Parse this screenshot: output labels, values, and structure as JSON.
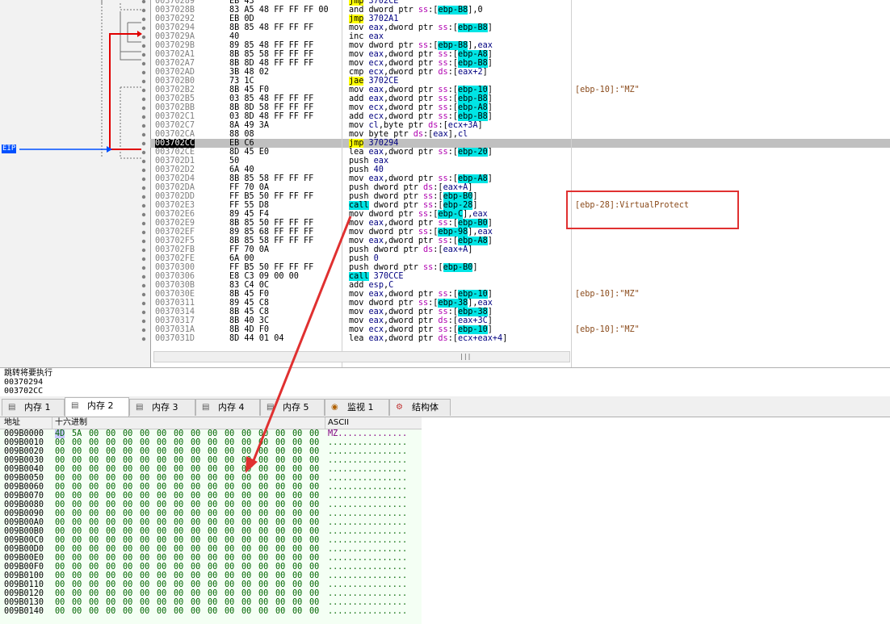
{
  "cpu": {
    "eip_label": "EIP",
    "rows": [
      {
        "addr": "00370289",
        "bytes": "EB 43",
        "dis": [
          [
            "jmp",
            "jmp"
          ],
          [
            "num",
            " 3702CE"
          ]
        ],
        "cmt": ""
      },
      {
        "addr": "0037028B",
        "bytes": "83 A5 48 FF FF FF 00",
        "dis": [
          [
            "t",
            "and dword ptr "
          ],
          [
            "seg",
            "ss"
          ],
          [
            "t",
            ":["
          ],
          [
            "br",
            "ebp-B8"
          ],
          [
            "t",
            "],0"
          ]
        ],
        "cmt": ""
      },
      {
        "addr": "00370292",
        "bytes": "EB 0D",
        "dis": [
          [
            "jmp",
            "jmp"
          ],
          [
            "num",
            " 3702A1"
          ]
        ],
        "cmt": ""
      },
      {
        "addr": "00370294",
        "bytes": "8B 85 48 FF FF FF",
        "dis": [
          [
            "t",
            "mov "
          ],
          [
            "reg",
            "eax"
          ],
          [
            "t",
            ",dword ptr "
          ],
          [
            "seg",
            "ss"
          ],
          [
            "t",
            ":["
          ],
          [
            "br",
            "ebp-B8"
          ],
          [
            "t",
            "]"
          ]
        ],
        "cmt": ""
      },
      {
        "addr": "0037029A",
        "bytes": "40",
        "dis": [
          [
            "t",
            "inc "
          ],
          [
            "reg",
            "eax"
          ]
        ],
        "cmt": ""
      },
      {
        "addr": "0037029B",
        "bytes": "89 85 48 FF FF FF",
        "dis": [
          [
            "t",
            "mov dword ptr "
          ],
          [
            "seg",
            "ss"
          ],
          [
            "t",
            ":["
          ],
          [
            "br",
            "ebp-B8"
          ],
          [
            "t",
            "],"
          ],
          [
            "reg",
            "eax"
          ]
        ],
        "cmt": ""
      },
      {
        "addr": "003702A1",
        "bytes": "8B 85 58 FF FF FF",
        "dis": [
          [
            "t",
            "mov "
          ],
          [
            "reg",
            "eax"
          ],
          [
            "t",
            ",dword ptr "
          ],
          [
            "seg",
            "ss"
          ],
          [
            "t",
            ":["
          ],
          [
            "br",
            "ebp-A8"
          ],
          [
            "t",
            "]"
          ]
        ],
        "cmt": ""
      },
      {
        "addr": "003702A7",
        "bytes": "8B 8D 48 FF FF FF",
        "dis": [
          [
            "t",
            "mov "
          ],
          [
            "reg",
            "ecx"
          ],
          [
            "t",
            ",dword ptr "
          ],
          [
            "seg",
            "ss"
          ],
          [
            "t",
            ":["
          ],
          [
            "br",
            "ebp-B8"
          ],
          [
            "t",
            "]"
          ]
        ],
        "cmt": ""
      },
      {
        "addr": "003702AD",
        "bytes": "3B 48 02",
        "dis": [
          [
            "t",
            "cmp "
          ],
          [
            "reg",
            "ecx"
          ],
          [
            "t",
            ",dword ptr "
          ],
          [
            "seg",
            "ds"
          ],
          [
            "t",
            ":["
          ],
          [
            "reg",
            "eax+2"
          ],
          [
            "t",
            "]"
          ]
        ],
        "cmt": ""
      },
      {
        "addr": "003702B0",
        "bytes": "73 1C",
        "dis": [
          [
            "jmp",
            "jae"
          ],
          [
            "num",
            " 3702CE"
          ]
        ],
        "cmt": ""
      },
      {
        "addr": "003702B2",
        "bytes": "8B 45 F0",
        "dis": [
          [
            "t",
            "mov "
          ],
          [
            "reg",
            "eax"
          ],
          [
            "t",
            ",dword ptr "
          ],
          [
            "seg",
            "ss"
          ],
          [
            "t",
            ":["
          ],
          [
            "br",
            "ebp-10"
          ],
          [
            "t",
            "]"
          ]
        ],
        "cmt": "[ebp-10]:\"MZ\""
      },
      {
        "addr": "003702B5",
        "bytes": "03 85 48 FF FF FF",
        "dis": [
          [
            "t",
            "add "
          ],
          [
            "reg",
            "eax"
          ],
          [
            "t",
            ",dword ptr "
          ],
          [
            "seg",
            "ss"
          ],
          [
            "t",
            ":["
          ],
          [
            "br",
            "ebp-B8"
          ],
          [
            "t",
            "]"
          ]
        ],
        "cmt": ""
      },
      {
        "addr": "003702BB",
        "bytes": "8B 8D 58 FF FF FF",
        "dis": [
          [
            "t",
            "mov "
          ],
          [
            "reg",
            "ecx"
          ],
          [
            "t",
            ",dword ptr "
          ],
          [
            "seg",
            "ss"
          ],
          [
            "t",
            ":["
          ],
          [
            "br",
            "ebp-A8"
          ],
          [
            "t",
            "]"
          ]
        ],
        "cmt": ""
      },
      {
        "addr": "003702C1",
        "bytes": "03 8D 48 FF FF FF",
        "dis": [
          [
            "t",
            "add "
          ],
          [
            "reg",
            "ecx"
          ],
          [
            "t",
            ",dword ptr "
          ],
          [
            "seg",
            "ss"
          ],
          [
            "t",
            ":["
          ],
          [
            "br",
            "ebp-B8"
          ],
          [
            "t",
            "]"
          ]
        ],
        "cmt": ""
      },
      {
        "addr": "003702C7",
        "bytes": "8A 49 3A",
        "dis": [
          [
            "t",
            "mov "
          ],
          [
            "reg",
            "cl"
          ],
          [
            "t",
            ",byte ptr "
          ],
          [
            "seg",
            "ds"
          ],
          [
            "t",
            ":["
          ],
          [
            "reg",
            "ecx+3A"
          ],
          [
            "t",
            "]"
          ]
        ],
        "cmt": ""
      },
      {
        "addr": "003702CA",
        "bytes": "88 08",
        "dis": [
          [
            "t",
            "mov byte ptr "
          ],
          [
            "seg",
            "ds"
          ],
          [
            "t",
            ":["
          ],
          [
            "reg",
            "eax"
          ],
          [
            "t",
            "],"
          ],
          [
            "reg",
            "cl"
          ]
        ],
        "cmt": ""
      },
      {
        "addr": "003702CC",
        "bytes": "EB C6",
        "dis": [
          [
            "jmp",
            "jmp"
          ],
          [
            "num",
            " 370294"
          ]
        ],
        "cmt": "",
        "current": true
      },
      {
        "addr": "003702CE",
        "bytes": "8D 45 E0",
        "dis": [
          [
            "t",
            "lea "
          ],
          [
            "reg",
            "eax"
          ],
          [
            "t",
            ",dword ptr "
          ],
          [
            "seg",
            "ss"
          ],
          [
            "t",
            ":["
          ],
          [
            "br",
            "ebp-20"
          ],
          [
            "t",
            "]"
          ]
        ],
        "cmt": ""
      },
      {
        "addr": "003702D1",
        "bytes": "50",
        "dis": [
          [
            "t",
            "push "
          ],
          [
            "reg",
            "eax"
          ]
        ],
        "cmt": ""
      },
      {
        "addr": "003702D2",
        "bytes": "6A 40",
        "dis": [
          [
            "t",
            "push "
          ],
          [
            "num",
            "40"
          ]
        ],
        "cmt": ""
      },
      {
        "addr": "003702D4",
        "bytes": "8B 85 58 FF FF FF",
        "dis": [
          [
            "t",
            "mov "
          ],
          [
            "reg",
            "eax"
          ],
          [
            "t",
            ",dword ptr "
          ],
          [
            "seg",
            "ss"
          ],
          [
            "t",
            ":["
          ],
          [
            "br",
            "ebp-A8"
          ],
          [
            "t",
            "]"
          ]
        ],
        "cmt": ""
      },
      {
        "addr": "003702DA",
        "bytes": "FF 70 0A",
        "dis": [
          [
            "t",
            "push dword ptr "
          ],
          [
            "seg",
            "ds"
          ],
          [
            "t",
            ":["
          ],
          [
            "reg",
            "eax+A"
          ],
          [
            "t",
            "]"
          ]
        ],
        "cmt": ""
      },
      {
        "addr": "003702DD",
        "bytes": "FF B5 50 FF FF FF",
        "dis": [
          [
            "t",
            "push dword ptr "
          ],
          [
            "seg",
            "ss"
          ],
          [
            "t",
            ":["
          ],
          [
            "br",
            "ebp-B0"
          ],
          [
            "t",
            "]"
          ]
        ],
        "cmt": ""
      },
      {
        "addr": "003702E3",
        "bytes": "FF 55 D8",
        "dis": [
          [
            "call",
            "call"
          ],
          [
            "t",
            " dword ptr "
          ],
          [
            "seg",
            "ss"
          ],
          [
            "t",
            ":["
          ],
          [
            "br",
            "ebp-28"
          ],
          [
            "t",
            "]"
          ]
        ],
        "cmt": "[ebp-28]:VirtualProtect"
      },
      {
        "addr": "003702E6",
        "bytes": "89 45 F4",
        "dis": [
          [
            "t",
            "mov dword ptr "
          ],
          [
            "seg",
            "ss"
          ],
          [
            "t",
            ":["
          ],
          [
            "br",
            "ebp-C"
          ],
          [
            "t",
            "],"
          ],
          [
            "reg",
            "eax"
          ]
        ],
        "cmt": ""
      },
      {
        "addr": "003702E9",
        "bytes": "8B 85 50 FF FF FF",
        "dis": [
          [
            "t",
            "mov "
          ],
          [
            "reg",
            "eax"
          ],
          [
            "t",
            ",dword ptr "
          ],
          [
            "seg",
            "ss"
          ],
          [
            "t",
            ":["
          ],
          [
            "br",
            "ebp-B0"
          ],
          [
            "t",
            "]"
          ]
        ],
        "cmt": ""
      },
      {
        "addr": "003702EF",
        "bytes": "89 85 68 FF FF FF",
        "dis": [
          [
            "t",
            "mov dword ptr "
          ],
          [
            "seg",
            "ss"
          ],
          [
            "t",
            ":["
          ],
          [
            "br",
            "ebp-98"
          ],
          [
            "t",
            "],"
          ],
          [
            "reg",
            "eax"
          ]
        ],
        "cmt": ""
      },
      {
        "addr": "003702F5",
        "bytes": "8B 85 58 FF FF FF",
        "dis": [
          [
            "t",
            "mov "
          ],
          [
            "reg",
            "eax"
          ],
          [
            "t",
            ",dword ptr "
          ],
          [
            "seg",
            "ss"
          ],
          [
            "t",
            ":["
          ],
          [
            "br",
            "ebp-A8"
          ],
          [
            "t",
            "]"
          ]
        ],
        "cmt": ""
      },
      {
        "addr": "003702FB",
        "bytes": "FF 70 0A",
        "dis": [
          [
            "t",
            "push dword ptr "
          ],
          [
            "seg",
            "ds"
          ],
          [
            "t",
            ":["
          ],
          [
            "reg",
            "eax+A"
          ],
          [
            "t",
            "]"
          ]
        ],
        "cmt": ""
      },
      {
        "addr": "003702FE",
        "bytes": "6A 00",
        "dis": [
          [
            "t",
            "push "
          ],
          [
            "num",
            "0"
          ]
        ],
        "cmt": ""
      },
      {
        "addr": "00370300",
        "bytes": "FF B5 50 FF FF FF",
        "dis": [
          [
            "t",
            "push dword ptr "
          ],
          [
            "seg",
            "ss"
          ],
          [
            "t",
            ":["
          ],
          [
            "br",
            "ebp-B0"
          ],
          [
            "t",
            "]"
          ]
        ],
        "cmt": ""
      },
      {
        "addr": "00370306",
        "bytes": "E8 C3 09 00 00",
        "dis": [
          [
            "call",
            "call"
          ],
          [
            "num",
            " 370CCE"
          ]
        ],
        "cmt": ""
      },
      {
        "addr": "0037030B",
        "bytes": "83 C4 0C",
        "dis": [
          [
            "t",
            "add "
          ],
          [
            "reg",
            "esp"
          ],
          [
            "t",
            ","
          ],
          [
            "num",
            "C"
          ]
        ],
        "cmt": ""
      },
      {
        "addr": "0037030E",
        "bytes": "8B 45 F0",
        "dis": [
          [
            "t",
            "mov "
          ],
          [
            "reg",
            "eax"
          ],
          [
            "t",
            ",dword ptr "
          ],
          [
            "seg",
            "ss"
          ],
          [
            "t",
            ":["
          ],
          [
            "br",
            "ebp-10"
          ],
          [
            "t",
            "]"
          ]
        ],
        "cmt": "[ebp-10]:\"MZ\""
      },
      {
        "addr": "00370311",
        "bytes": "89 45 C8",
        "dis": [
          [
            "t",
            "mov dword ptr "
          ],
          [
            "seg",
            "ss"
          ],
          [
            "t",
            ":["
          ],
          [
            "br",
            "ebp-38"
          ],
          [
            "t",
            "],"
          ],
          [
            "reg",
            "eax"
          ]
        ],
        "cmt": ""
      },
      {
        "addr": "00370314",
        "bytes": "8B 45 C8",
        "dis": [
          [
            "t",
            "mov "
          ],
          [
            "reg",
            "eax"
          ],
          [
            "t",
            ",dword ptr "
          ],
          [
            "seg",
            "ss"
          ],
          [
            "t",
            ":["
          ],
          [
            "br",
            "ebp-38"
          ],
          [
            "t",
            "]"
          ]
        ],
        "cmt": ""
      },
      {
        "addr": "00370317",
        "bytes": "8B 40 3C",
        "dis": [
          [
            "t",
            "mov "
          ],
          [
            "reg",
            "eax"
          ],
          [
            "t",
            ",dword ptr "
          ],
          [
            "seg",
            "ds"
          ],
          [
            "t",
            ":["
          ],
          [
            "reg",
            "eax+3C"
          ],
          [
            "t",
            "]"
          ]
        ],
        "cmt": ""
      },
      {
        "addr": "0037031A",
        "bytes": "8B 4D F0",
        "dis": [
          [
            "t",
            "mov "
          ],
          [
            "reg",
            "ecx"
          ],
          [
            "t",
            ",dword ptr "
          ],
          [
            "seg",
            "ss"
          ],
          [
            "t",
            ":["
          ],
          [
            "br",
            "ebp-10"
          ],
          [
            "t",
            "]"
          ]
        ],
        "cmt": "[ebp-10]:\"MZ\""
      },
      {
        "addr": "0037031D",
        "bytes": "8D 44 01 04",
        "dis": [
          [
            "t",
            "lea "
          ],
          [
            "reg",
            "eax"
          ],
          [
            "t",
            ",dword ptr "
          ],
          [
            "seg",
            "ds"
          ],
          [
            "t",
            ":["
          ],
          [
            "reg",
            "ecx+eax+4"
          ],
          [
            "t",
            "]"
          ]
        ],
        "cmt": ""
      }
    ],
    "scroll_mark": "|||"
  },
  "info": {
    "line1": "跳转将要执行",
    "line2": "00370294",
    "line3": "003702CC"
  },
  "tabs": [
    {
      "label": "内存 1",
      "icon": "memory-icon",
      "active": false
    },
    {
      "label": "内存 2",
      "icon": "memory-icon",
      "active": true
    },
    {
      "label": "内存 3",
      "icon": "memory-icon",
      "active": false
    },
    {
      "label": "内存 4",
      "icon": "memory-icon",
      "active": false
    },
    {
      "label": "内存 5",
      "icon": "memory-icon",
      "active": false
    },
    {
      "label": "监视 1",
      "icon": "watch-icon",
      "active": false
    },
    {
      "label": "结构体",
      "icon": "struct-icon",
      "active": false
    }
  ],
  "dump": {
    "header_addr": "地址",
    "header_hex": "十六进制",
    "header_ascii": "ASCII",
    "first_row_hex": [
      "4D",
      "5A",
      "00",
      "00",
      "00",
      "00",
      "00",
      "00",
      "00",
      "00",
      "00",
      "00",
      "00",
      "00",
      "00",
      "00"
    ],
    "first_row_ascii": "MZ..............",
    "zero_row_hex": "00",
    "zero_row_ascii": "................",
    "addresses": [
      "009B0000",
      "009B0010",
      "009B0020",
      "009B0030",
      "009B0040",
      "009B0050",
      "009B0060",
      "009B0070",
      "009B0080",
      "009B0090",
      "009B00A0",
      "009B00B0",
      "009B00C0",
      "009B00D0",
      "009B00E0",
      "009B00F0",
      "009B0100",
      "009B0110",
      "009B0120",
      "009B0130",
      "009B0140"
    ]
  },
  "colors": {
    "highlight_box": "#e03030",
    "arrow": "#e03030",
    "jump_line": "#e00000",
    "eip_arrow": "#0050ff"
  }
}
